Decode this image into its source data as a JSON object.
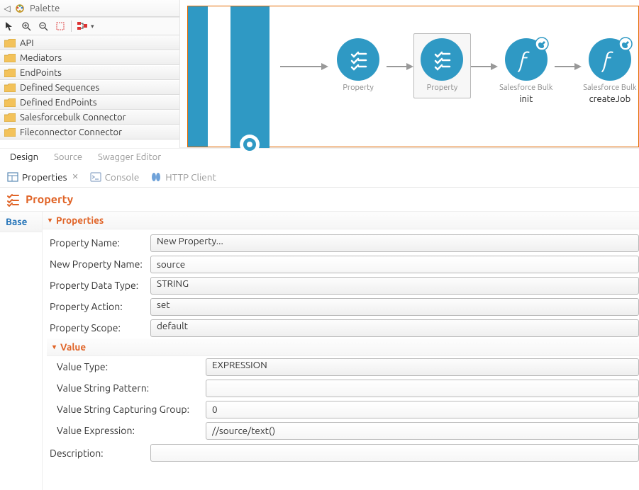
{
  "palette": {
    "title": "Palette",
    "items": [
      {
        "label": "API"
      },
      {
        "label": "Mediators"
      },
      {
        "label": "EndPoints"
      },
      {
        "label": "Defined Sequences"
      },
      {
        "label": "Defined EndPoints"
      },
      {
        "label": "Salesforcebulk Connector"
      },
      {
        "label": "Fileconnector Connector"
      }
    ]
  },
  "canvas": {
    "nodes": [
      {
        "type": "property",
        "label": "Property"
      },
      {
        "type": "property",
        "label": "Property",
        "selected": true
      },
      {
        "type": "connector",
        "topLabel": "Salesforce Bulk",
        "label": "init"
      },
      {
        "type": "connector",
        "topLabel": "Salesforce Bulk",
        "label": "createJob"
      }
    ]
  },
  "editorTabs": [
    "Design",
    "Source",
    "Swagger Editor"
  ],
  "activeEditorTab": "Design",
  "viewTabs": [
    {
      "label": "Properties",
      "active": true
    },
    {
      "label": "Console",
      "active": false
    },
    {
      "label": "HTTP Client",
      "active": false
    }
  ],
  "propertyPanel": {
    "title": "Property",
    "sideTab": "Base",
    "section": "Properties",
    "fields": {
      "propertyName": {
        "label": "Property Name:",
        "value": "New Property..."
      },
      "newPropertyName": {
        "label": "New Property Name:",
        "value": "source"
      },
      "propertyDataType": {
        "label": "Property Data Type:",
        "value": "STRING"
      },
      "propertyAction": {
        "label": "Property Action:",
        "value": "set"
      },
      "propertyScope": {
        "label": "Property Scope:",
        "value": "default"
      }
    },
    "valueSection": "Value",
    "valueFields": {
      "valueType": {
        "label": "Value Type:",
        "value": "EXPRESSION"
      },
      "valueStringPattern": {
        "label": "Value String Pattern:",
        "value": ""
      },
      "valueStringCapturingGroup": {
        "label": "Value String Capturing Group:",
        "value": "0"
      },
      "valueExpression": {
        "label": "Value Expression:",
        "value": "//source/text()"
      }
    },
    "description": {
      "label": "Description:",
      "value": ""
    }
  }
}
